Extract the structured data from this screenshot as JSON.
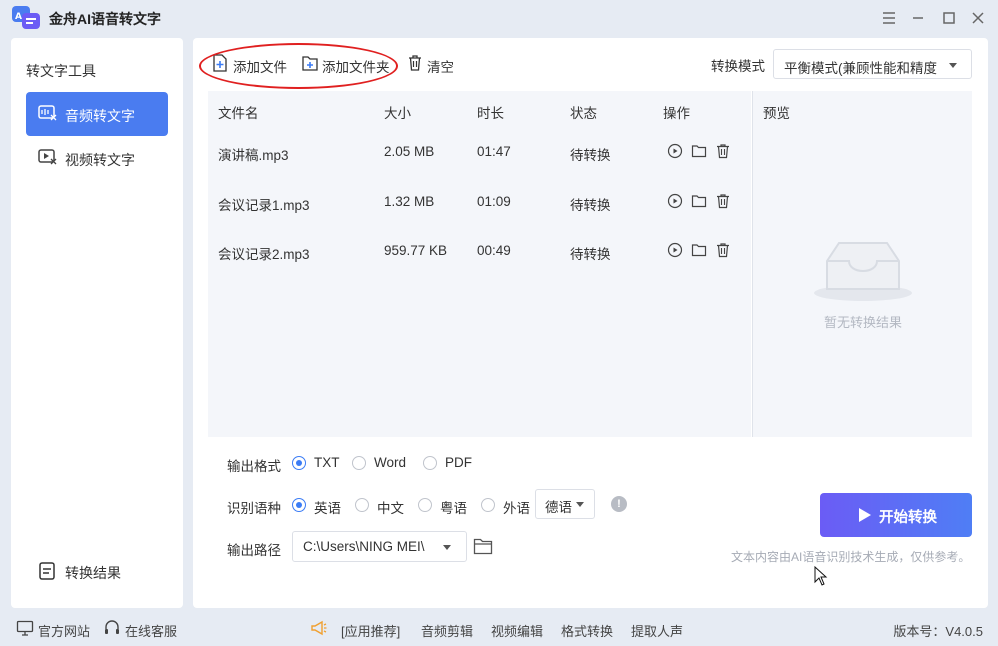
{
  "app": {
    "title": "金舟AI语音转文字",
    "accent_color": "#4a7cf0"
  },
  "window_controls": [
    "menu-icon",
    "minimize-icon",
    "maximize-icon",
    "close-icon"
  ],
  "sidebar": {
    "title": "转文字工具",
    "items": [
      {
        "label": "音频转文字",
        "icon": "audio-to-text-icon",
        "active": true
      },
      {
        "label": "视频转文字",
        "icon": "video-to-text-icon",
        "active": false
      }
    ],
    "result_label": "转换结果"
  },
  "toolbar": {
    "add_file": "添加文件",
    "add_folder": "添加文件夹",
    "clear": "清空",
    "mode_label": "转换模式",
    "mode_value": "平衡模式(兼顾性能和精度"
  },
  "table": {
    "headers": [
      "文件名",
      "大小",
      "时长",
      "状态",
      "操作"
    ],
    "rows": [
      {
        "name": "演讲稿.mp3",
        "size": "2.05 MB",
        "duration": "01:47",
        "status": "待转换"
      },
      {
        "name": "会议记录1.mp3",
        "size": "1.32 MB",
        "duration": "01:09",
        "status": "待转换"
      },
      {
        "name": "会议记录2.mp3",
        "size": "959.77 KB",
        "duration": "00:49",
        "status": "待转换"
      }
    ]
  },
  "preview": {
    "title": "预览",
    "empty_text": "暂无转换结果"
  },
  "output_format": {
    "label": "输出格式",
    "options": [
      "TXT",
      "Word",
      "PDF"
    ],
    "selected": "TXT"
  },
  "language": {
    "label": "识别语种",
    "options": [
      "英语",
      "中文",
      "粤语",
      "外语"
    ],
    "selected": "英语",
    "foreign_value": "德语"
  },
  "output_path": {
    "label": "输出路径",
    "value": "C:\\Users\\NING MEI\\"
  },
  "start_button": "开始转换",
  "disclaimer": "文本内容由AI语音识别技术生成，仅供参考。",
  "footer": {
    "website": "官方网站",
    "service": "在线客服",
    "recommend": "[应用推荐]",
    "links": [
      "音频剪辑",
      "视频编辑",
      "格式转换",
      "提取人声"
    ],
    "version": "版本号：V4.0.5"
  }
}
